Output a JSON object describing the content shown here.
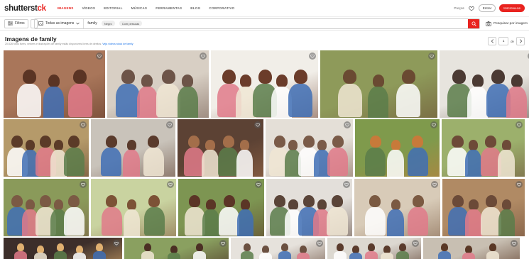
{
  "header": {
    "logo_main": "shutterst",
    "logo_accent": "ck",
    "nav_tabs": [
      {
        "label": "IMAGENS",
        "active": true
      },
      {
        "label": "VÍDEOS",
        "active": false
      },
      {
        "label": "EDITORIAL",
        "active": false
      },
      {
        "label": "MÚSICAS",
        "active": false
      },
      {
        "label": "FERRAMENTAS",
        "active": false
      },
      {
        "label": "BLOG",
        "active": false
      },
      {
        "label": "CORPORATIVO",
        "active": false
      }
    ],
    "pricing_link": "Preços",
    "login_button": "Entrar",
    "signup_button": "Inscreva-se"
  },
  "search": {
    "filters_label": "Filtros",
    "media_type": "Todas as imagens",
    "query": "family",
    "chips": [
      "Negro",
      "Com pessoas"
    ],
    "image_search_label": "Pesquisar por imagem"
  },
  "results": {
    "title": "Imagens de family",
    "subtitle": "20.626 fotos livres, vetores e ilustrações de family estão disponíveis livres de direitos.",
    "more_link": "Veja vídeos stock de family",
    "page": "1",
    "total_pages": "de"
  },
  "colors": {
    "brand_red": "#e9231f",
    "link_blue": "#1a73e8"
  },
  "tiles": [
    {
      "row": 0,
      "desc": "family-on-sofa-laughing",
      "bg": "#a9765a",
      "accent": "#5a3424"
    },
    {
      "row": 0,
      "desc": "family-on-couch-living-room",
      "bg": "#d8cfc4",
      "accent": "#6d5448"
    },
    {
      "row": 0,
      "desc": "family-hug-light-blue",
      "bg": "#f1eee8",
      "accent": "#6b3c2a"
    },
    {
      "row": 0,
      "desc": "family-backyard-picnic",
      "bg": "#8e9a5a",
      "accent": "#6a4a32"
    },
    {
      "row": 0,
      "desc": "family-living-room-floor",
      "bg": "#e7e4de",
      "accent": "#4b3a33"
    },
    {
      "row": 1,
      "desc": "family-couch-smiling",
      "bg": "#b59a6a",
      "accent": "#5b3b28"
    },
    {
      "row": 1,
      "desc": "family-lying-together",
      "bg": "#c9c3ba",
      "accent": "#5a3b2c"
    },
    {
      "row": 1,
      "desc": "family-kitchen-warm",
      "bg": "#5c4234",
      "accent": "#a36e4a"
    },
    {
      "row": 1,
      "desc": "family-dance-living-room",
      "bg": "#e4dfd7",
      "accent": "#7a5b48"
    },
    {
      "row": 1,
      "desc": "family-dinner-table-aerial",
      "bg": "#7f9a4c",
      "accent": "#c77a3a"
    },
    {
      "row": 1,
      "desc": "family-portrait-park",
      "bg": "#9cb06c",
      "accent": "#6d4a38"
    },
    {
      "row": 2,
      "desc": "family-biking-park",
      "bg": "#8a9a5a",
      "accent": "#7b5a44"
    },
    {
      "row": 2,
      "desc": "family-playing-outdoors",
      "bg": "#c9d3a0",
      "accent": "#7c5236"
    },
    {
      "row": 2,
      "desc": "family-group-outdoor",
      "bg": "#7d9552",
      "accent": "#5b3526"
    },
    {
      "row": 2,
      "desc": "family-dancing-home",
      "bg": "#e3dfda",
      "accent": "#5a4438"
    },
    {
      "row": 2,
      "desc": "family-cozy-living-room",
      "bg": "#d8cbb8",
      "accent": "#7b5a42"
    },
    {
      "row": 2,
      "desc": "family-camping-van",
      "bg": "#b08a64",
      "accent": "#6b4a38"
    },
    {
      "row": 3,
      "desc": "family-string-lights",
      "bg": "#3c2e2a",
      "accent": "#e0b070"
    },
    {
      "row": 3,
      "desc": "family-outdoor-smiles",
      "bg": "#8aa060",
      "accent": "#4b2f24"
    },
    {
      "row": 3,
      "desc": "family-window-room",
      "bg": "#e6e2dc",
      "accent": "#6b5040"
    },
    {
      "row": 3,
      "desc": "family-bright-interior",
      "bg": "#dcd8d0",
      "accent": "#5a3b2c"
    },
    {
      "row": 3,
      "desc": "family-portrait-group",
      "bg": "#c8bfb2",
      "accent": "#5a3826"
    }
  ]
}
